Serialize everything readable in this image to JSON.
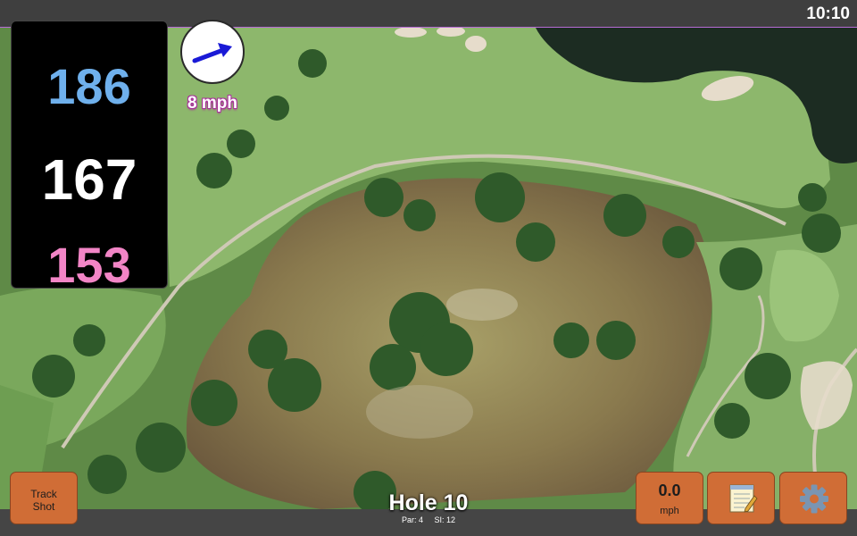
{
  "status_bar": {
    "time": "10:10"
  },
  "distances": {
    "back": "186",
    "center": "167",
    "front": "153"
  },
  "wind": {
    "speed_label": "8 mph",
    "direction_icon": "wind-arrow-icon"
  },
  "buttons": {
    "track_shot_line1": "Track",
    "track_shot_line2": "Shot",
    "wind_value": "0.0",
    "wind_unit": "mph",
    "notes_icon": "notepad-icon",
    "settings_icon": "gear-icon"
  },
  "hole": {
    "title": "Hole 10",
    "par": "Par: 4",
    "si": "SI: 12"
  },
  "colors": {
    "back_distance": "#6fb0ec",
    "center_distance": "#ffffff",
    "front_distance": "#f285c6",
    "button": "#d06d36",
    "accent": "#b76bd6"
  },
  "map": {
    "type": "satellite-golf-course"
  }
}
